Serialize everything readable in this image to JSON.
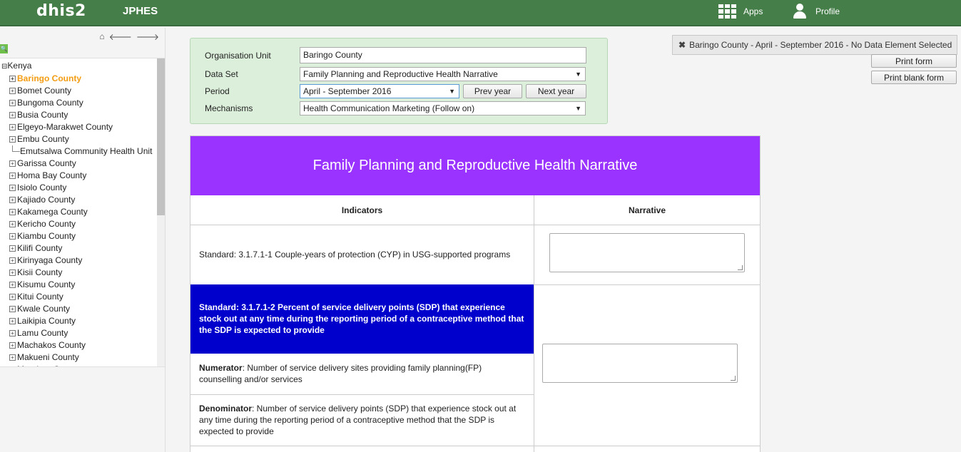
{
  "header": {
    "logo": "dhis2",
    "app_name": "JPHES",
    "apps_label": "Apps",
    "profile_label": "Profile",
    "apps_icon": "apps-grid-icon",
    "profile_icon": "user-icon"
  },
  "tree": {
    "root": "Kenya",
    "items": [
      {
        "label": "Baringo County",
        "selected": true
      },
      {
        "label": "Bomet County"
      },
      {
        "label": "Bungoma County"
      },
      {
        "label": "Busia County"
      },
      {
        "label": "Elgeyo-Marakwet County"
      },
      {
        "label": "Embu County"
      },
      {
        "label": "Emutsalwa Community Health Unit",
        "leaf": true
      },
      {
        "label": "Garissa County"
      },
      {
        "label": "Homa Bay County"
      },
      {
        "label": "Isiolo County"
      },
      {
        "label": "Kajiado County"
      },
      {
        "label": "Kakamega County"
      },
      {
        "label": "Kericho County"
      },
      {
        "label": "Kiambu County"
      },
      {
        "label": "Kilifi County"
      },
      {
        "label": "Kirinyaga County"
      },
      {
        "label": "Kisii County"
      },
      {
        "label": "Kisumu County"
      },
      {
        "label": "Kitui County"
      },
      {
        "label": "Kwale County"
      },
      {
        "label": "Laikipia County"
      },
      {
        "label": "Lamu County"
      },
      {
        "label": "Machakos County"
      },
      {
        "label": "Makueni County"
      },
      {
        "label": "Mandera County"
      }
    ]
  },
  "criteria": {
    "org_unit_label": "Organisation Unit",
    "org_unit_value": "Baringo County",
    "dataset_label": "Data Set",
    "dataset_value": "Family Planning and Reproductive Health Narrative",
    "period_label": "Period",
    "period_value": "April - September 2016",
    "prev_year": "Prev year",
    "next_year": "Next year",
    "mechanisms_label": "Mechanisms",
    "mechanisms_value": "Health Communication Marketing (Follow on)"
  },
  "notice": {
    "text": "Baringo County - April - September 2016 - No Data Element Selected"
  },
  "actions": {
    "print_form": "Print form",
    "print_blank_form": "Print blank form"
  },
  "form": {
    "title": "Family Planning and Reproductive Health Narrative",
    "col_indicators": "Indicators",
    "col_narrative": "Narrative",
    "row1": "Standard: 3.1.7.1-1 Couple-years of protection (CYP) in USG-supported programs",
    "row2_label": "Standard",
    "row2_text": ": 3.1.7.1-2 Percent of service delivery points (SDP) that experience stock out at any time during the reporting period of a contraceptive method that the SDP is expected to provide",
    "numerator_label": "Numerator",
    "numerator_text": ": Number of service delivery sites providing family planning(FP) counselling and/or services",
    "denominator_label": "Denominator",
    "denominator_text": ": Number of service delivery points (SDP) that experience stock out at any time during the reporting period of a contraceptive method that the SDP is expected to provide"
  }
}
